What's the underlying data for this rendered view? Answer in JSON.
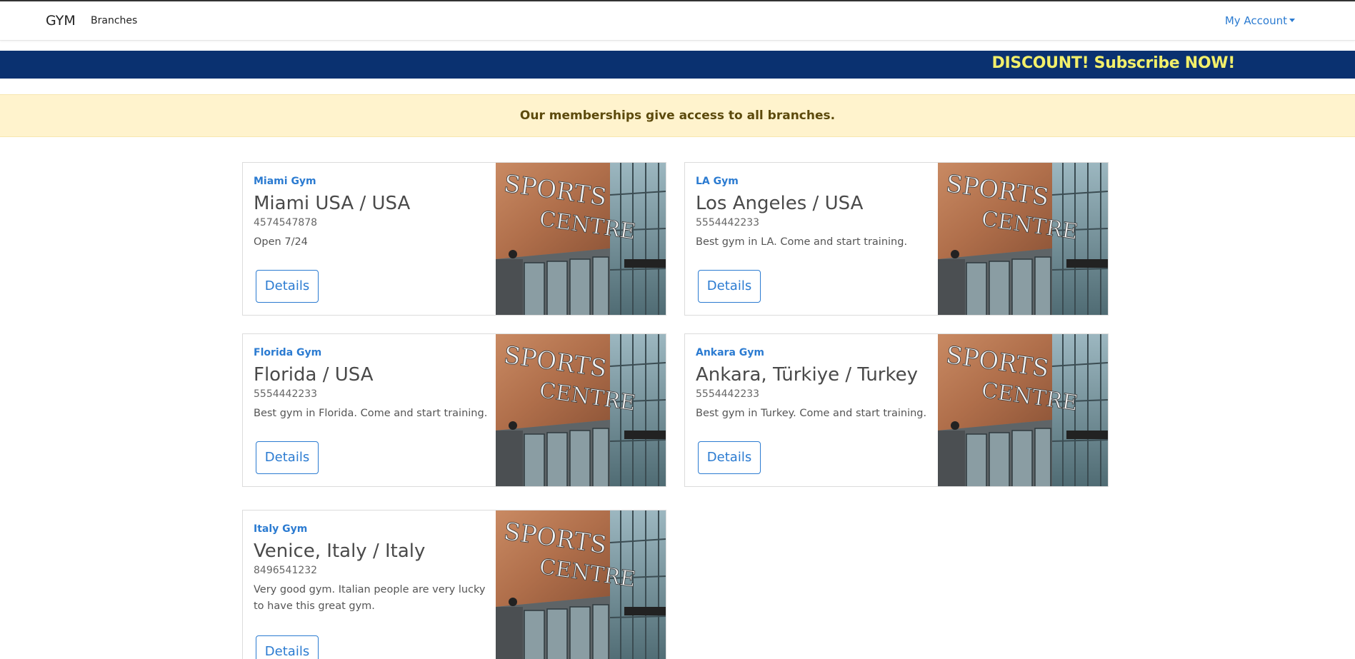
{
  "nav": {
    "brand": "GYM",
    "links": [
      "Branches"
    ],
    "account_label": "My Account"
  },
  "promo": {
    "text": "DISCOUNT! Subscribe NOW!",
    "background": "#0a3170",
    "text_color": "#f2ef6a"
  },
  "notice": {
    "text": "Our memberships give access to all branches."
  },
  "image_alt": "SPORTS CENTRE",
  "branches": [
    {
      "name": "Miami Gym",
      "location": "Miami USA / USA",
      "phone": "4574547878",
      "description": "Open 7/24",
      "button": "Details"
    },
    {
      "name": "LA Gym",
      "location": "Los Angeles / USA",
      "phone": "5554442233",
      "description": "Best gym in LA. Come and start training.",
      "button": "Details"
    },
    {
      "name": "Florida Gym",
      "location": "Florida / USA",
      "phone": "5554442233",
      "description": "Best gym in Florida. Come and start training.",
      "button": "Details"
    },
    {
      "name": "Ankara Gym",
      "location": "Ankara, Türkiye / Turkey",
      "phone": "5554442233",
      "description": "Best gym in Turkey. Come and start training.",
      "button": "Details"
    },
    {
      "name": "Italy Gym",
      "location": "Venice, Italy / Italy",
      "phone": "8496541232",
      "description": "Very good gym. Italian people are very lucky to have this great gym.",
      "button": "Details"
    }
  ],
  "colors": {
    "accent": "#2b7bd1",
    "notice_bg": "#fff3cd"
  }
}
